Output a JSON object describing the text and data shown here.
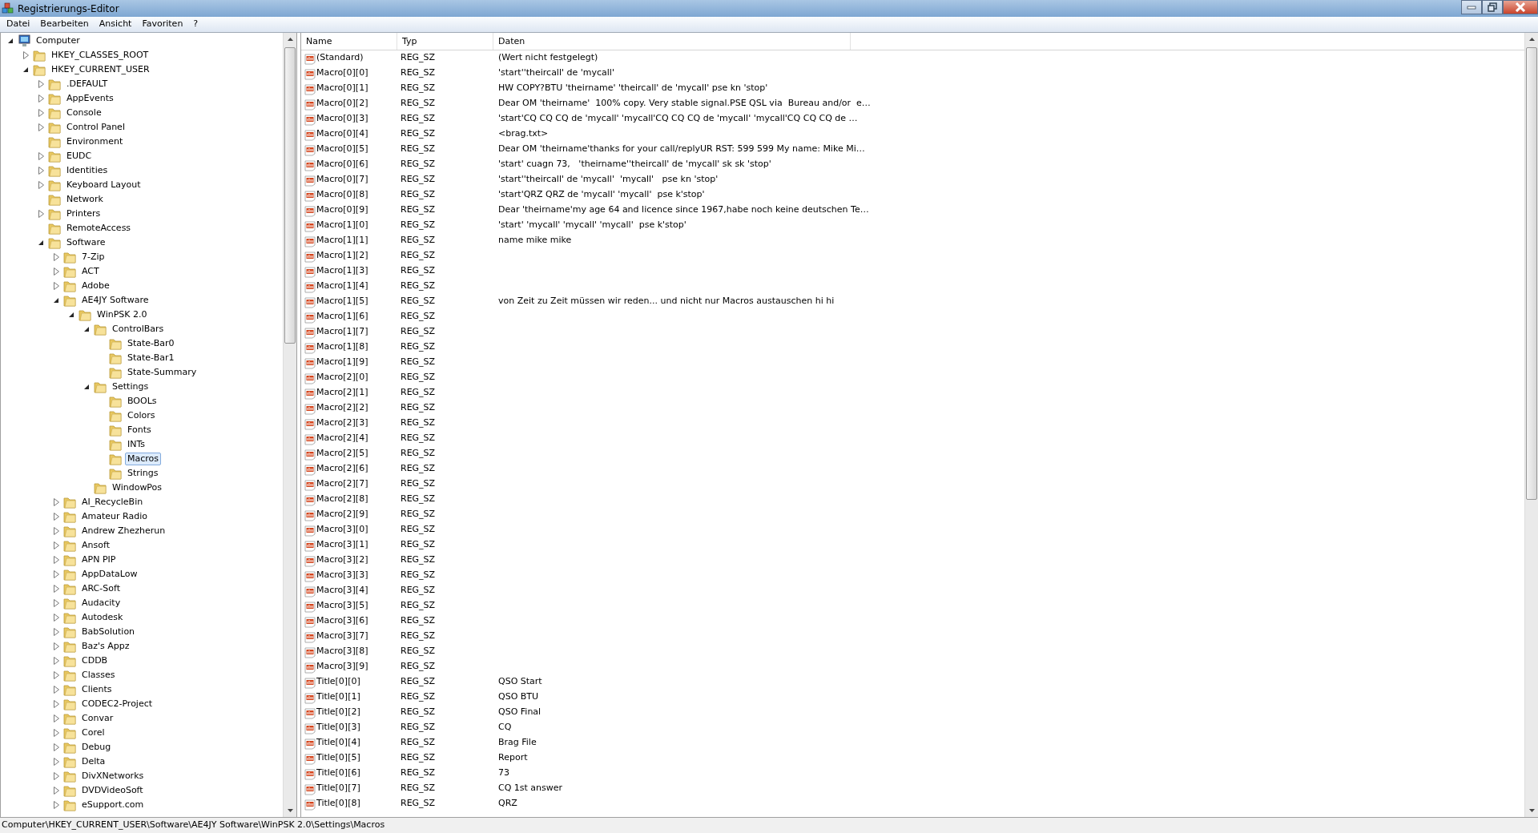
{
  "window": {
    "title": "Registrierungs-Editor"
  },
  "menu": [
    "Datei",
    "Bearbeiten",
    "Ansicht",
    "Favoriten",
    "?"
  ],
  "tree": [
    {
      "label": "Computer",
      "expanded": true,
      "selected": false,
      "children": [
        {
          "label": "HKEY_CLASSES_ROOT",
          "expanded": false,
          "selected": false
        },
        {
          "label": "HKEY_CURRENT_USER",
          "expanded": true,
          "selected": false,
          "children": [
            {
              "label": ".DEFAULT",
              "expanded": false,
              "selected": false
            },
            {
              "label": "AppEvents",
              "expanded": false,
              "selected": false
            },
            {
              "label": "Console",
              "expanded": false,
              "selected": false
            },
            {
              "label": "Control Panel",
              "expanded": false,
              "selected": false
            },
            {
              "label": "Environment",
              "selected": false
            },
            {
              "label": "EUDC",
              "expanded": false,
              "selected": false
            },
            {
              "label": "Identities",
              "expanded": false,
              "selected": false
            },
            {
              "label": "Keyboard Layout",
              "expanded": false,
              "selected": false
            },
            {
              "label": "Network",
              "selected": false
            },
            {
              "label": "Printers",
              "expanded": false,
              "selected": false
            },
            {
              "label": "RemoteAccess",
              "selected": false
            },
            {
              "label": "Software",
              "expanded": true,
              "selected": false,
              "children": [
                {
                  "label": "7-Zip",
                  "expanded": false,
                  "selected": false
                },
                {
                  "label": "ACT",
                  "expanded": false,
                  "selected": false
                },
                {
                  "label": "Adobe",
                  "expanded": false,
                  "selected": false
                },
                {
                  "label": "AE4JY Software",
                  "expanded": true,
                  "selected": false,
                  "children": [
                    {
                      "label": "WinPSK 2.0",
                      "expanded": true,
                      "selected": false,
                      "children": [
                        {
                          "label": "ControlBars",
                          "expanded": true,
                          "selected": false,
                          "children": [
                            {
                              "label": "State-Bar0",
                              "selected": false
                            },
                            {
                              "label": "State-Bar1",
                              "selected": false
                            },
                            {
                              "label": "State-Summary",
                              "selected": false
                            }
                          ]
                        },
                        {
                          "label": "Settings",
                          "expanded": true,
                          "selected": false,
                          "children": [
                            {
                              "label": "BOOLs",
                              "selected": false
                            },
                            {
                              "label": "Colors",
                              "selected": false
                            },
                            {
                              "label": "Fonts",
                              "selected": false
                            },
                            {
                              "label": "INTs",
                              "selected": false
                            },
                            {
                              "label": "Macros",
                              "selected": true
                            },
                            {
                              "label": "Strings",
                              "selected": false
                            }
                          ]
                        },
                        {
                          "label": "WindowPos",
                          "selected": false
                        }
                      ]
                    }
                  ]
                },
                {
                  "label": "AI_RecycleBin",
                  "expanded": false,
                  "selected": false
                },
                {
                  "label": "Amateur Radio",
                  "expanded": false,
                  "selected": false
                },
                {
                  "label": "Andrew Zhezherun",
                  "expanded": false,
                  "selected": false
                },
                {
                  "label": "Ansoft",
                  "expanded": false,
                  "selected": false
                },
                {
                  "label": "APN PIP",
                  "expanded": false,
                  "selected": false
                },
                {
                  "label": "AppDataLow",
                  "expanded": false,
                  "selected": false
                },
                {
                  "label": "ARC-Soft",
                  "expanded": false,
                  "selected": false
                },
                {
                  "label": "Audacity",
                  "expanded": false,
                  "selected": false
                },
                {
                  "label": "Autodesk",
                  "expanded": false,
                  "selected": false
                },
                {
                  "label": "BabSolution",
                  "expanded": false,
                  "selected": false
                },
                {
                  "label": "Baz's Appz",
                  "expanded": false,
                  "selected": false
                },
                {
                  "label": "CDDB",
                  "expanded": false,
                  "selected": false
                },
                {
                  "label": "Classes",
                  "expanded": false,
                  "selected": false
                },
                {
                  "label": "Clients",
                  "expanded": false,
                  "selected": false
                },
                {
                  "label": "CODEC2-Project",
                  "expanded": false,
                  "selected": false
                },
                {
                  "label": "Convar",
                  "expanded": false,
                  "selected": false
                },
                {
                  "label": "Corel",
                  "expanded": false,
                  "selected": false
                },
                {
                  "label": "Debug",
                  "expanded": false,
                  "selected": false
                },
                {
                  "label": "Delta",
                  "expanded": false,
                  "selected": false
                },
                {
                  "label": "DivXNetworks",
                  "expanded": false,
                  "selected": false
                },
                {
                  "label": "DVDVideoSoft",
                  "expanded": false,
                  "selected": false
                },
                {
                  "label": "eSupport.com",
                  "expanded": false,
                  "selected": false
                }
              ]
            }
          ]
        }
      ]
    }
  ],
  "table": {
    "columns": [
      "Name",
      "Typ",
      "Daten"
    ],
    "rows": [
      {
        "name": "(Standard)",
        "type": "REG_SZ",
        "data": "(Wert nicht festgelegt)"
      },
      {
        "name": "Macro[0][0]",
        "type": "REG_SZ",
        "data": "'start''theircall' de 'mycall'"
      },
      {
        "name": "Macro[0][1]",
        "type": "REG_SZ",
        "data": "HW COPY?BTU 'theirname' 'theircall' de 'mycall' pse kn 'stop'"
      },
      {
        "name": "Macro[0][2]",
        "type": "REG_SZ",
        "data": "Dear OM 'theirname'  100% copy. Very stable signal.PSE QSL via  Bureau and/or  e…"
      },
      {
        "name": "Macro[0][3]",
        "type": "REG_SZ",
        "data": "'start'CQ CQ CQ de 'mycall' 'mycall'CQ CQ CQ de 'mycall' 'mycall'CQ CQ CQ de …"
      },
      {
        "name": "Macro[0][4]",
        "type": "REG_SZ",
        "data": "<brag.txt>"
      },
      {
        "name": "Macro[0][5]",
        "type": "REG_SZ",
        "data": "Dear OM 'theirname'thanks for your call/replyUR RST: 599 599 My name: Mike Mi…"
      },
      {
        "name": "Macro[0][6]",
        "type": "REG_SZ",
        "data": "'start' cuagn 73,   'theirname''theircall' de 'mycall' sk sk 'stop'"
      },
      {
        "name": "Macro[0][7]",
        "type": "REG_SZ",
        "data": "'start''theircall' de 'mycall'  'mycall'   pse kn 'stop'"
      },
      {
        "name": "Macro[0][8]",
        "type": "REG_SZ",
        "data": "'start'QRZ QRZ de 'mycall' 'mycall'  pse k'stop'"
      },
      {
        "name": "Macro[0][9]",
        "type": "REG_SZ",
        "data": "Dear 'theirname'my age 64 and licence since 1967,habe noch keine deutschen Te…"
      },
      {
        "name": "Macro[1][0]",
        "type": "REG_SZ",
        "data": "'start' 'mycall' 'mycall' 'mycall'  pse k'stop'"
      },
      {
        "name": "Macro[1][1]",
        "type": "REG_SZ",
        "data": "name mike mike"
      },
      {
        "name": "Macro[1][2]",
        "type": "REG_SZ"
      },
      {
        "name": "Macro[1][3]",
        "type": "REG_SZ"
      },
      {
        "name": "Macro[1][4]",
        "type": "REG_SZ"
      },
      {
        "name": "Macro[1][5]",
        "type": "REG_SZ",
        "data": "von Zeit zu Zeit müssen wir reden... und nicht nur Macros austauschen hi hi"
      },
      {
        "name": "Macro[1][6]",
        "type": "REG_SZ"
      },
      {
        "name": "Macro[1][7]",
        "type": "REG_SZ"
      },
      {
        "name": "Macro[1][8]",
        "type": "REG_SZ"
      },
      {
        "name": "Macro[1][9]",
        "type": "REG_SZ"
      },
      {
        "name": "Macro[2][0]",
        "type": "REG_SZ"
      },
      {
        "name": "Macro[2][1]",
        "type": "REG_SZ"
      },
      {
        "name": "Macro[2][2]",
        "type": "REG_SZ"
      },
      {
        "name": "Macro[2][3]",
        "type": "REG_SZ"
      },
      {
        "name": "Macro[2][4]",
        "type": "REG_SZ"
      },
      {
        "name": "Macro[2][5]",
        "type": "REG_SZ"
      },
      {
        "name": "Macro[2][6]",
        "type": "REG_SZ"
      },
      {
        "name": "Macro[2][7]",
        "type": "REG_SZ"
      },
      {
        "name": "Macro[2][8]",
        "type": "REG_SZ"
      },
      {
        "name": "Macro[2][9]",
        "type": "REG_SZ"
      },
      {
        "name": "Macro[3][0]",
        "type": "REG_SZ"
      },
      {
        "name": "Macro[3][1]",
        "type": "REG_SZ"
      },
      {
        "name": "Macro[3][2]",
        "type": "REG_SZ"
      },
      {
        "name": "Macro[3][3]",
        "type": "REG_SZ"
      },
      {
        "name": "Macro[3][4]",
        "type": "REG_SZ"
      },
      {
        "name": "Macro[3][5]",
        "type": "REG_SZ"
      },
      {
        "name": "Macro[3][6]",
        "type": "REG_SZ"
      },
      {
        "name": "Macro[3][7]",
        "type": "REG_SZ"
      },
      {
        "name": "Macro[3][8]",
        "type": "REG_SZ"
      },
      {
        "name": "Macro[3][9]",
        "type": "REG_SZ"
      },
      {
        "name": "Title[0][0]",
        "type": "REG_SZ",
        "data": "QSO Start"
      },
      {
        "name": "Title[0][1]",
        "type": "REG_SZ",
        "data": "QSO BTU"
      },
      {
        "name": "Title[0][2]",
        "type": "REG_SZ",
        "data": "QSO Final"
      },
      {
        "name": "Title[0][3]",
        "type": "REG_SZ",
        "data": "CQ"
      },
      {
        "name": "Title[0][4]",
        "type": "REG_SZ",
        "data": "Brag File"
      },
      {
        "name": "Title[0][5]",
        "type": "REG_SZ",
        "data": "Report"
      },
      {
        "name": "Title[0][6]",
        "type": "REG_SZ",
        "data": "73"
      },
      {
        "name": "Title[0][7]",
        "type": "REG_SZ",
        "data": "CQ 1st answer"
      },
      {
        "name": "Title[0][8]",
        "type": "REG_SZ",
        "data": "QRZ"
      }
    ]
  },
  "status_bar": "Computer\\HKEY_CURRENT_USER\\Software\\AE4JY Software\\WinPSK 2.0\\Settings\\Macros"
}
